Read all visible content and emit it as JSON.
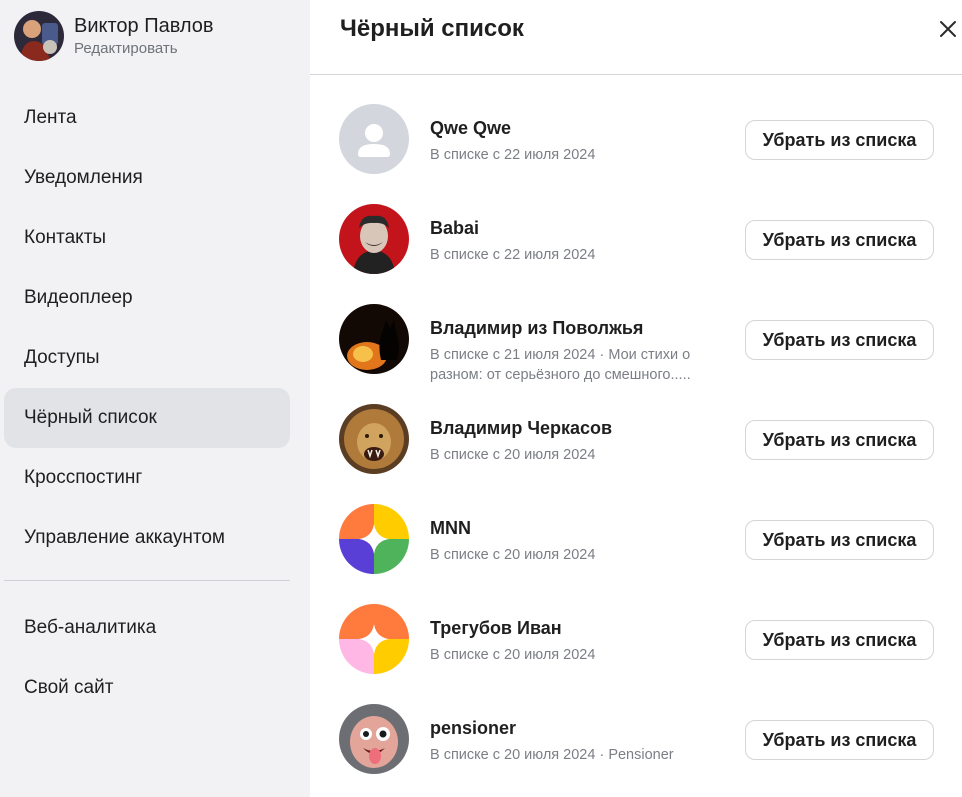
{
  "profile": {
    "name": "Виктор Павлов",
    "edit_link": "Редактировать"
  },
  "nav": {
    "items": [
      {
        "label": "Лента"
      },
      {
        "label": "Уведомления"
      },
      {
        "label": "Контакты"
      },
      {
        "label": "Видеоплеер"
      },
      {
        "label": "Доступы"
      },
      {
        "label": "Чёрный список",
        "active": true
      },
      {
        "label": "Кросспостинг"
      },
      {
        "label": "Управление аккаунтом"
      }
    ],
    "secondary_items": [
      {
        "label": "Веб-аналитика"
      },
      {
        "label": "Свой сайт"
      }
    ]
  },
  "main": {
    "title": "Чёрный список",
    "close_icon": "close-icon",
    "remove_label": "Убрать из списка",
    "blocked": [
      {
        "name": "Qwe Qwe",
        "subtitle": "В списке с 22 июля 2024",
        "avatar": "default-user-avatar"
      },
      {
        "name": "Babai",
        "subtitle": "В списке с 22 июля 2024",
        "avatar": "portrait-photo-red"
      },
      {
        "name": "Владимир из Поволжья",
        "subtitle": "В списке с 21 июля 2024 · Мои стихи о разном: от серьёзного до смешного.....",
        "avatar": "cat-fire-photo"
      },
      {
        "name": "Владимир Черкасов",
        "subtitle": "В списке с 20 июля 2024",
        "avatar": "lion-photo"
      },
      {
        "name": "MNN",
        "subtitle": "В списке с 20 июля 2024",
        "avatar": "colorful-logo"
      },
      {
        "name": "Трегубов Иван",
        "subtitle": "В списке с 20 июля 2024",
        "avatar": "colorful-logo-pink"
      },
      {
        "name": "pensioner",
        "subtitle": "В списке с 20 июля 2024 · Pensioner",
        "avatar": "funny-face-photo"
      }
    ]
  },
  "colors": {
    "sidebar_bg": "#f2f2f5",
    "active_item_bg": "#e2e3e7",
    "text_primary": "#1f1f1f",
    "text_secondary": "#7b7f85",
    "border": "#d4d5d8"
  }
}
